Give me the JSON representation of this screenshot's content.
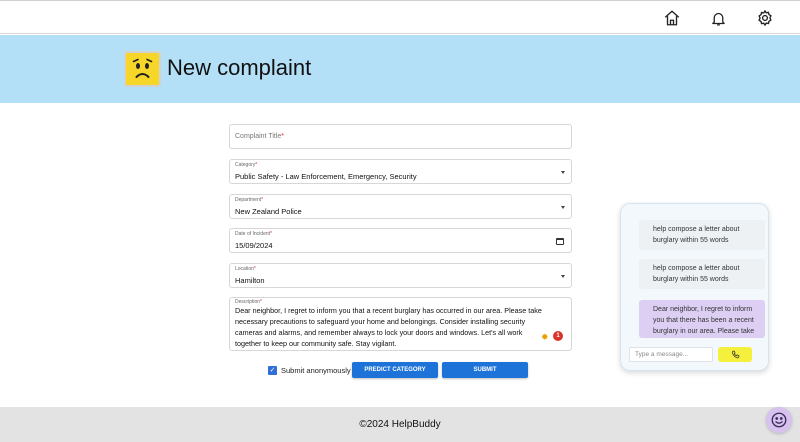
{
  "header": {
    "icons": [
      "home-icon",
      "bell-icon",
      "gear-icon"
    ]
  },
  "banner": {
    "title": "New complaint",
    "emoji": "worried-face"
  },
  "form": {
    "complaint_title": {
      "placeholder": "Complaint Title",
      "required_mark": "*",
      "value": ""
    },
    "category": {
      "label": "Category",
      "required_mark": "*",
      "value": "Public Safety - Law Enforcement, Emergency, Security"
    },
    "department": {
      "label": "Department",
      "required_mark": "*",
      "value": "New Zealand Police"
    },
    "date": {
      "label": "Date of Incident",
      "required_mark": "*",
      "value": "15/09/2024"
    },
    "location": {
      "label": "Location",
      "required_mark": "*",
      "value": "Hamilton"
    },
    "description": {
      "label": "Description",
      "required_mark": "*",
      "value": "Dear neighbor, I regret to inform you that a recent burglary has occurred in our area. Please take necessary precautions to safeguard your home and belongings. Consider installing security cameras and alarms, and remember always to lock your doors and windows. Let's all work together to keep our community safe. Stay vigilant.",
      "badge_count": "1"
    },
    "anonymous": {
      "label": "Submit anonymously",
      "checked": true
    },
    "predict_button": "PREDICT CATEGORY",
    "submit_button": "SUBMIT"
  },
  "chat": {
    "messages": [
      {
        "role": "user",
        "text": "help compose a letter about burglary within 55 words"
      },
      {
        "role": "user",
        "text": "help compose a letter about burglary within 55 words"
      },
      {
        "role": "bot",
        "text": "Dear neighbor, I regret to inform you that there has been a recent burglary in our area. Please take necessary..."
      }
    ],
    "input_placeholder": "Type a message..."
  },
  "footer": {
    "copyright": "©2024 HelpBuddy"
  },
  "colors": {
    "banner_bg": "#b3e0f6",
    "primary_button": "#1e73d9",
    "chat_bot_bubble": "#dccff3",
    "mic_button": "#f5ef3e",
    "footer_bg": "#e3e3e3"
  }
}
